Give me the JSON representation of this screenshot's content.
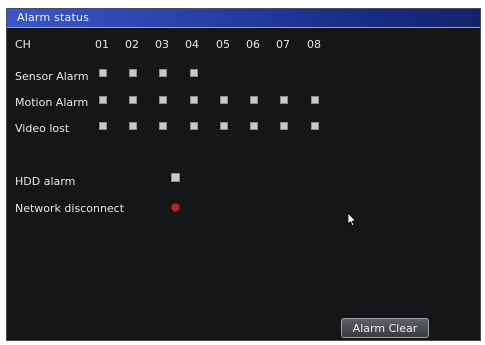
{
  "window": {
    "title": "Alarm status"
  },
  "header": {
    "label": "CH",
    "channels": [
      "01",
      "02",
      "03",
      "04",
      "05",
      "06",
      "07",
      "08"
    ]
  },
  "rows": [
    {
      "label": "Sensor Alarm",
      "indicators": 4
    },
    {
      "label": "Motion Alarm",
      "indicators": 8
    },
    {
      "label": "Video lost",
      "indicators": 8
    }
  ],
  "hdd": {
    "label": "HDD alarm",
    "status": "normal"
  },
  "network": {
    "label": "Network disconnect",
    "status": "alarm"
  },
  "buttons": {
    "clear_label": "Alarm Clear"
  },
  "colors": {
    "title_bar": "#2a43ad",
    "background": "#151618",
    "indicator_off": "#c9c9c9",
    "indicator_alarm": "#c41f2a"
  }
}
